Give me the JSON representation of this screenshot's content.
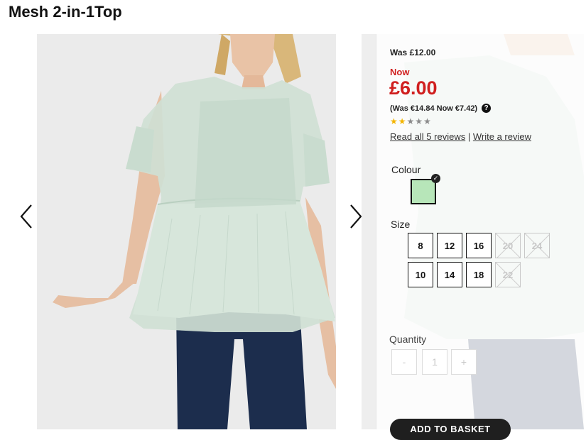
{
  "product": {
    "title": "Mesh 2-in-1Top"
  },
  "pricing": {
    "was": "Was £12.00",
    "now_label": "Now",
    "now_price": "£6.00",
    "euro_text": "(Was €14.84 Now €7.42)",
    "help_icon": "?"
  },
  "rating": {
    "value": 2,
    "max": 5,
    "filled_color": "#f4b400"
  },
  "reviews": {
    "read_link": "Read all 5 reviews",
    "separator": "|",
    "write_link": "Write a review"
  },
  "colour": {
    "label": "Colour",
    "selected": "#b7e6b9",
    "check_icon": "✓"
  },
  "size": {
    "label": "Size",
    "options": [
      {
        "value": "8",
        "available": true
      },
      {
        "value": "12",
        "available": true
      },
      {
        "value": "16",
        "available": true
      },
      {
        "value": "20",
        "available": false
      },
      {
        "value": "24",
        "available": false
      },
      {
        "value": "10",
        "available": true
      },
      {
        "value": "14",
        "available": true
      },
      {
        "value": "18",
        "available": true
      },
      {
        "value": "22",
        "available": false
      }
    ]
  },
  "quantity": {
    "label": "Quantity",
    "minus": "-",
    "value": "1",
    "plus": "+"
  },
  "basket": {
    "label": "ADD TO BASKET"
  },
  "gallery": {
    "prev_icon": "chevron-left-icon",
    "next_icon": "chevron-right-icon"
  },
  "colors": {
    "price_red": "#d01f1f",
    "star_gold": "#f4b400"
  }
}
